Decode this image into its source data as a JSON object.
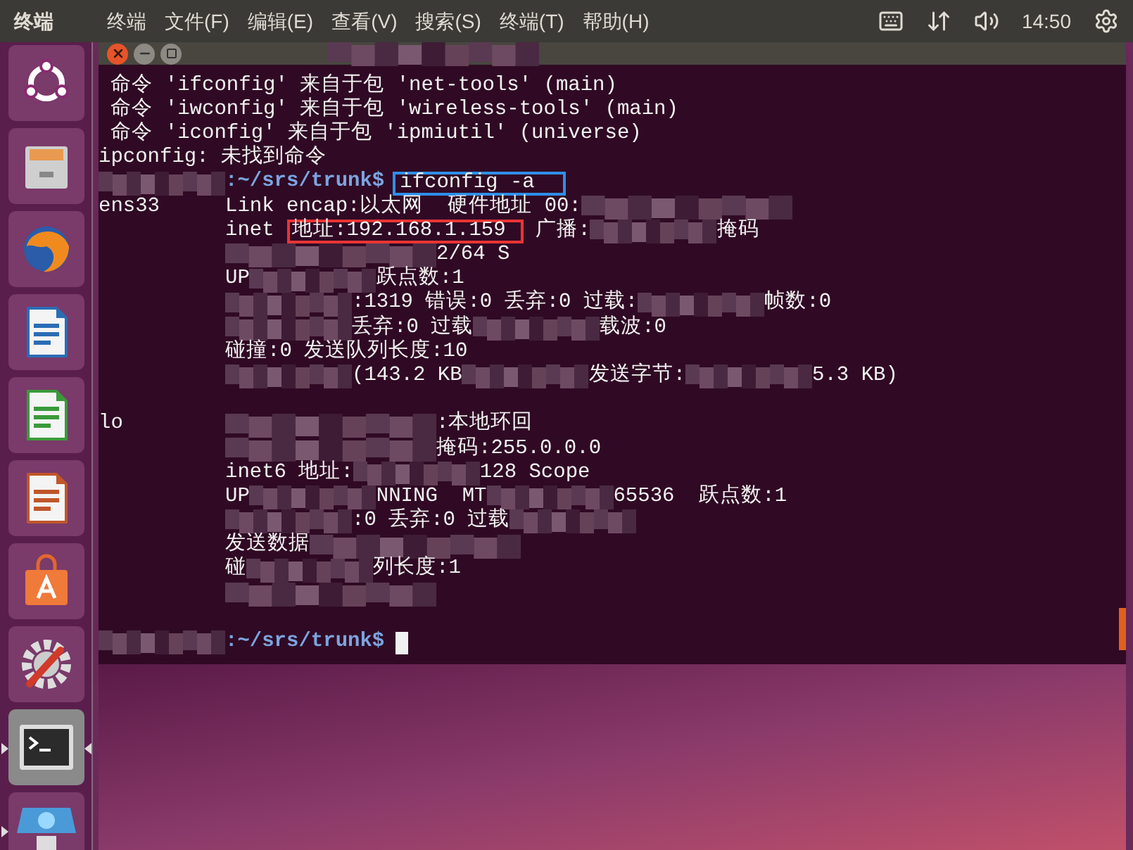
{
  "top_bar": {
    "app_name": "终端",
    "menus": [
      "终端",
      "文件(F)",
      "编辑(E)",
      "查看(V)",
      "搜索(S)",
      "终端(T)",
      "帮助(H)"
    ],
    "clock": "14:50"
  },
  "launcher": {
    "items": [
      {
        "kind": "ubuntu",
        "running": false,
        "focused": false
      },
      {
        "kind": "files",
        "running": false,
        "focused": false
      },
      {
        "kind": "firefox",
        "running": false,
        "focused": false
      },
      {
        "kind": "writer",
        "running": false,
        "focused": false
      },
      {
        "kind": "calc",
        "running": false,
        "focused": false
      },
      {
        "kind": "impress",
        "running": false,
        "focused": false
      },
      {
        "kind": "store",
        "running": false,
        "focused": false
      },
      {
        "kind": "settings",
        "running": false,
        "focused": false
      },
      {
        "kind": "terminal",
        "running": true,
        "focused": true
      },
      {
        "kind": "workspaces",
        "running": true,
        "focused": false
      }
    ]
  },
  "terminal": {
    "lines": [
      {
        "kind": "plain",
        "parts": [
          {
            "kind": "text",
            "text": " 命令 'ifconfig' 来自于包 'net-tools' (main)"
          }
        ]
      },
      {
        "kind": "plain",
        "parts": [
          {
            "kind": "text",
            "text": " 命令 'iwconfig' 来自于包 'wireless-tools' (main)"
          }
        ]
      },
      {
        "kind": "plain",
        "parts": [
          {
            "kind": "text",
            "text": " 命令 'iconfig' 来自于包 'ipmiutil' (universe)"
          }
        ]
      },
      {
        "kind": "plain",
        "parts": [
          {
            "kind": "text",
            "text": "ipconfig: 未找到命令"
          }
        ]
      },
      {
        "kind": "prompt",
        "path": ":~/srs/trunk$",
        "command": "ifconfig -a",
        "color": "#2f8fe8"
      },
      {
        "kind": "detail",
        "label": "ens33",
        "parts": [
          {
            "kind": "text",
            "text": "Link encap:以太网  硬件地址 00:"
          },
          {
            "kind": "blur"
          }
        ]
      },
      {
        "kind": "detail",
        "parts": [
          {
            "kind": "text",
            "text": "inet "
          },
          {
            "kind": "text",
            "text": "地址:192.168.1.159 ",
            "color": "#e83535"
          },
          {
            "kind": "text",
            "text": " 广播:"
          },
          {
            "kind": "blur"
          },
          {
            "kind": "text",
            "text": "掩码"
          }
        ]
      },
      {
        "kind": "detail",
        "parts": [
          {
            "kind": "blur"
          },
          {
            "kind": "text",
            "text": "2/64 S"
          }
        ]
      },
      {
        "kind": "detail",
        "parts": [
          {
            "kind": "text",
            "text": "UP"
          },
          {
            "kind": "blur"
          },
          {
            "kind": "text",
            "text": "跃点数:1"
          }
        ]
      },
      {
        "kind": "detail",
        "parts": [
          {
            "kind": "blur"
          },
          {
            "kind": "text",
            "text": ":1319 错误:0 丢弃:0 过载:"
          },
          {
            "kind": "blur"
          },
          {
            "kind": "text",
            "text": "帧数:0"
          }
        ]
      },
      {
        "kind": "detail",
        "parts": [
          {
            "kind": "blur"
          },
          {
            "kind": "text",
            "text": "丢弃:0 过载"
          },
          {
            "kind": "blur"
          },
          {
            "kind": "text",
            "text": "载波:0"
          }
        ]
      },
      {
        "kind": "detail",
        "parts": [
          {
            "kind": "text",
            "text": "碰撞:0 发送队列长度:10"
          }
        ]
      },
      {
        "kind": "detail",
        "parts": [
          {
            "kind": "blur"
          },
          {
            "kind": "text",
            "text": "(143.2 KB"
          },
          {
            "kind": "blur"
          },
          {
            "kind": "text",
            "text": "发送字节:"
          },
          {
            "kind": "blur"
          },
          {
            "kind": "text",
            "text": "5.3 KB)"
          }
        ]
      },
      {
        "kind": "blank"
      },
      {
        "kind": "detail",
        "label": "lo",
        "parts": [
          {
            "kind": "blur"
          },
          {
            "kind": "text",
            "text": ":本地环回"
          }
        ]
      },
      {
        "kind": "detail",
        "parts": [
          {
            "kind": "blur"
          },
          {
            "kind": "text",
            "text": "掩码:255.0.0.0"
          }
        ]
      },
      {
        "kind": "detail",
        "parts": [
          {
            "kind": "text",
            "text": "inet6 地址:"
          },
          {
            "kind": "blur"
          },
          {
            "kind": "text",
            "text": "128 Scope"
          }
        ]
      },
      {
        "kind": "detail",
        "parts": [
          {
            "kind": "text",
            "text": "UP"
          },
          {
            "kind": "blur"
          },
          {
            "kind": "text",
            "text": "NNING  MT"
          },
          {
            "kind": "blur"
          },
          {
            "kind": "text",
            "text": "65536  跃点数:1"
          }
        ]
      },
      {
        "kind": "detail",
        "parts": [
          {
            "kind": "blur"
          },
          {
            "kind": "text",
            "text": ":0 丢弃:0 过载"
          },
          {
            "kind": "blur"
          }
        ]
      },
      {
        "kind": "detail",
        "parts": [
          {
            "kind": "text",
            "text": "发送数据"
          },
          {
            "kind": "blur"
          }
        ]
      },
      {
        "kind": "detail",
        "parts": [
          {
            "kind": "text",
            "text": "碰"
          },
          {
            "kind": "blur"
          },
          {
            "kind": "text",
            "text": "列长度:1"
          }
        ]
      },
      {
        "kind": "detail",
        "parts": [
          {
            "kind": "blur"
          }
        ]
      },
      {
        "kind": "blank"
      },
      {
        "kind": "prompt",
        "path": ":~/srs/trunk$",
        "cursor": true
      }
    ]
  }
}
